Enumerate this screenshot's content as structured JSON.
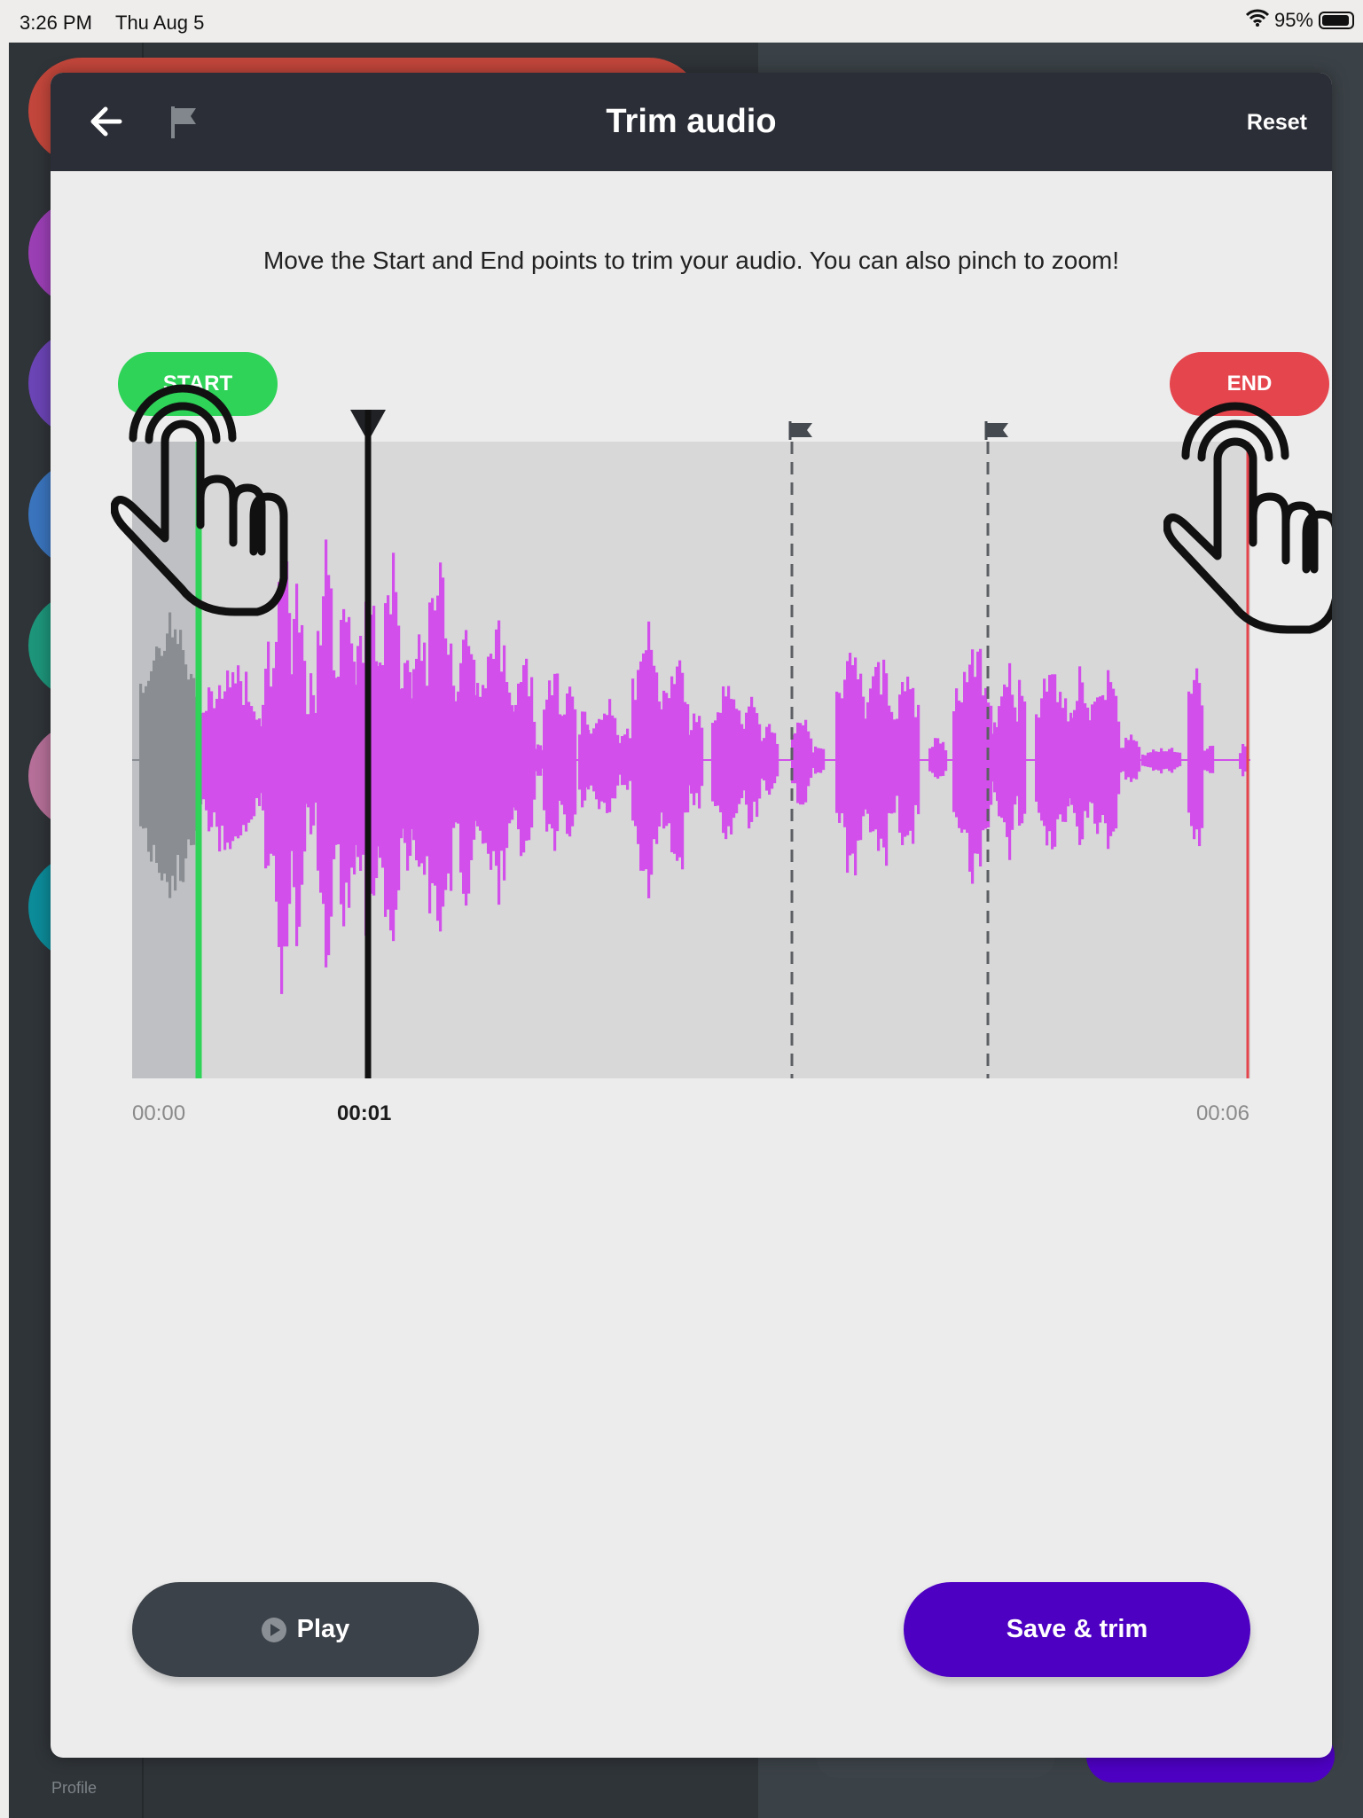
{
  "status_bar": {
    "time": "3:26 PM",
    "date": "Thu Aug 5",
    "battery": "95%"
  },
  "background_app": {
    "profile_label": "Profile"
  },
  "modal": {
    "title": "Trim audio",
    "reset_label": "Reset",
    "instructions": "Move the Start and End points to trim your audio. You can also pinch to zoom!",
    "start_label": "START",
    "end_label": "END",
    "time_labels": {
      "start": "00:00",
      "current": "00:01",
      "end": "00:06"
    },
    "play_label": "Play",
    "save_label": "Save & trim"
  },
  "colors": {
    "header": "#2b2e36",
    "start": "#2ed358",
    "end": "#e5454d",
    "waveform": "#d34fec",
    "trimmed": "#8a8e92",
    "save": "#4d00c2",
    "play": "#3c4249"
  },
  "icons": [
    "back-arrow-icon",
    "flag-icon",
    "wifi-icon",
    "battery-icon",
    "play-icon",
    "hand-tap-icon",
    "marker-flag-icon"
  ]
}
